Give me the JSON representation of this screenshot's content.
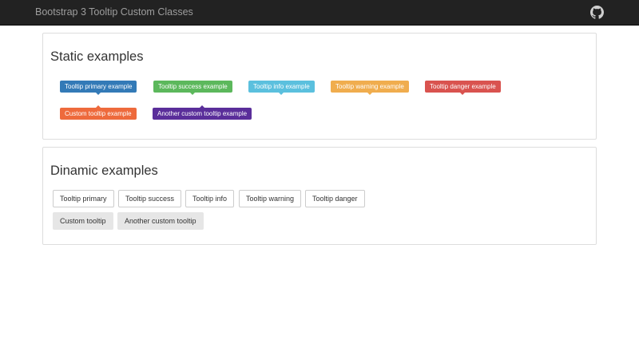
{
  "navbar": {
    "title": "Bootstrap 3 Tooltip Custom Classes",
    "icon": "github-icon"
  },
  "static_section": {
    "title": "Static examples",
    "tooltips": [
      {
        "label": "Tooltip primary example",
        "color": "#337ab7",
        "arrow": "down"
      },
      {
        "label": "Tooltip success example",
        "color": "#5cb85c",
        "arrow": "down"
      },
      {
        "label": "Tooltip info example",
        "color": "#5bc0de",
        "arrow": "down"
      },
      {
        "label": "Tooltip warning example",
        "color": "#f0ad4e",
        "arrow": "down"
      },
      {
        "label": "Tooltip danger example",
        "color": "#d9534f",
        "arrow": "down"
      },
      {
        "label": "Custom tooltip example",
        "color": "#ee6a3c",
        "arrow": "up"
      },
      {
        "label": "Another custom tooltip example",
        "color": "#5a2e9a",
        "arrow": "up"
      }
    ]
  },
  "dynamic_section": {
    "title": "Dinamic examples",
    "buttons": [
      {
        "label": "Tooltip primary",
        "style": "default"
      },
      {
        "label": "Tooltip success",
        "style": "default"
      },
      {
        "label": "Tooltip info",
        "style": "default"
      },
      {
        "label": "Tooltip warning",
        "style": "default"
      },
      {
        "label": "Tooltip danger",
        "style": "default"
      },
      {
        "label": "Custom tooltip",
        "style": "gray"
      },
      {
        "label": "Another custom tooltip",
        "style": "gray"
      }
    ]
  }
}
